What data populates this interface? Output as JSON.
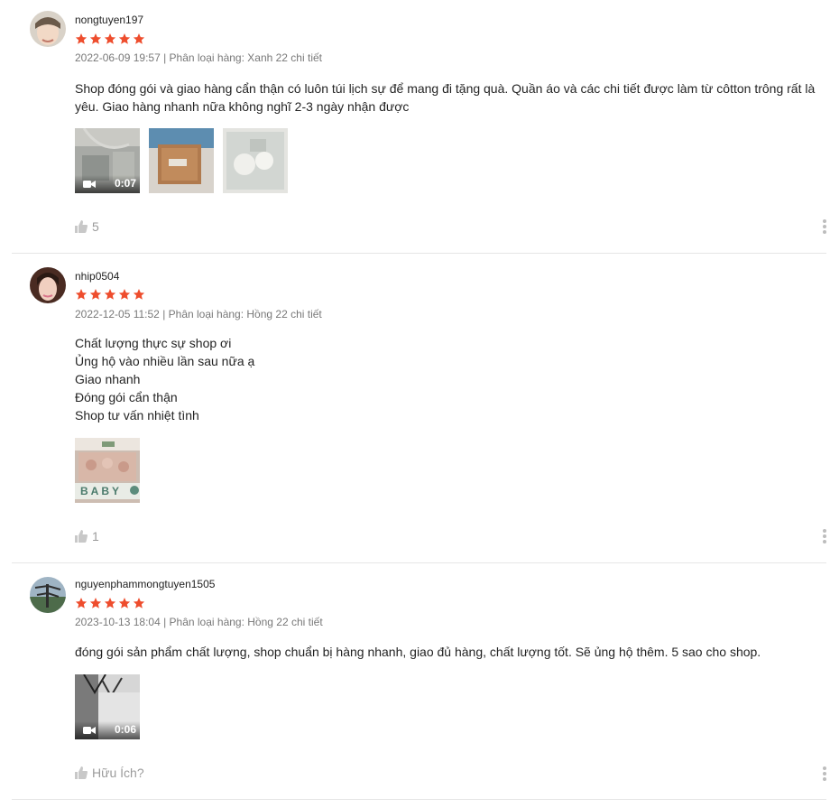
{
  "theme": {
    "star_color": "#ee4d2d",
    "divider_color": "#e6e6e6",
    "muted_text": "#8a8a8a"
  },
  "icons": {
    "star": "star-icon",
    "video": "video-camera-icon",
    "like": "thumbs-up-icon",
    "more": "more-vertical-icon"
  },
  "reviews": [
    {
      "username": "nongtuyen197",
      "rating": 5,
      "meta": "2022-06-09 19:57 | Phân loại hàng: Xanh 22 chi tiết",
      "content_lines": [
        "Shop đóng gói và giao hàng cẩn thận có luôn túi lịch sự để mang đi tặng quà. Quần áo và các chi tiết được làm từ côtton trông rất là yêu. Giao hàng nhanh nữa không nghĩ 2-3 ngày nhận được"
      ],
      "media": [
        {
          "type": "video",
          "duration": "0:07",
          "image": "photo-packaging-bag"
        },
        {
          "type": "image",
          "image": "photo-cardboard-box"
        },
        {
          "type": "image",
          "image": "photo-baby-clothes-set"
        }
      ],
      "likes": "5"
    },
    {
      "username": "nhip0504",
      "rating": 5,
      "meta": "2022-12-05 11:52 | Phân loại hàng: Hồng 22 chi tiết",
      "content_lines": [
        "Chất lượng thực sự shop ơi",
        "Ủng hộ vào nhiều lần sau nữa ạ",
        "Giao nhanh",
        "Đóng gói cẩn thận",
        "Shop tư vấn nhiệt tình"
      ],
      "media": [
        {
          "type": "image",
          "image": "photo-baby-gift-box",
          "caption": "BABY"
        }
      ],
      "likes": "1"
    },
    {
      "username": "nguyenphammongtuyen1505",
      "rating": 5,
      "meta": "2023-10-13 18:04 | Phân loại hàng: Hồng 22 chi tiết",
      "content_lines": [
        "đóng gói sản phẩm chất lượng, shop chuẩn bị hàng nhanh, giao đủ hàng, chất lượng tốt. Sẽ ủng hộ thêm. 5 sao cho shop."
      ],
      "media": [
        {
          "type": "video",
          "duration": "0:06",
          "image": "photo-gift-bag"
        }
      ],
      "likes": "Hữu Ích?"
    }
  ]
}
